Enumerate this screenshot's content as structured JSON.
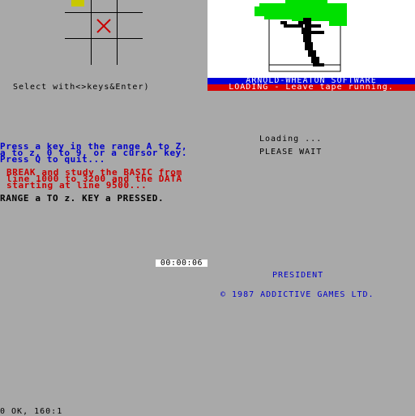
{
  "board": {
    "cursor_color": "#c8c800",
    "mark_color": "#c80000",
    "marks": [
      {
        "row": 1,
        "col": 1,
        "symbol": "X"
      }
    ]
  },
  "select_hint": "Select with<>keys&Enter)",
  "banner": {
    "title": "ARNOLD-WHEATON SOFTWARE",
    "status": "LOADING - Leave tape running."
  },
  "loader": {
    "loading": "Loading ...",
    "wait": "PLEASE WAIT"
  },
  "prompt": {
    "lines": [
      "Press a key in the range A to Z,",
      "a to z, 0 to 9, or a cursor key.",
      "Press Q to quit..."
    ]
  },
  "break_note": {
    "lines": [
      "BREAK and study the BASIC from",
      "line 1000 to 3200 and the DATA",
      "starting at line 9500..."
    ]
  },
  "key_result": "RANGE a TO z. KEY a PRESSED.",
  "timer": "00:00:06",
  "credits": {
    "game_title": "PRESIDENT",
    "copyright": "© 1987 ADDICTIVE GAMES LTD."
  },
  "status_line": "0 OK, 160:1"
}
